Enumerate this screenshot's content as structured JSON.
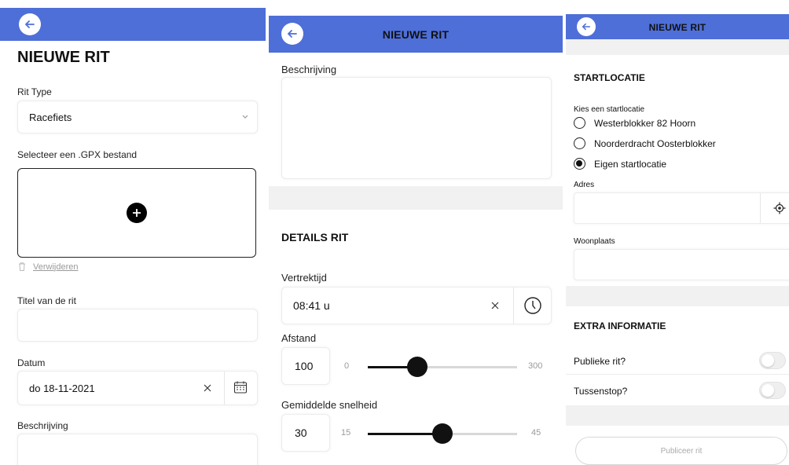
{
  "panel1": {
    "title": "NIEUWE RIT",
    "rit_type_label": "Rit Type",
    "rit_type_value": "Racefiets",
    "gpx_label": "Selecteer een .GPX bestand",
    "remove_label": "Verwijderen",
    "titel_label": "Titel van de rit",
    "titel_value": "",
    "datum_label": "Datum",
    "datum_value": "do 18-11-2021",
    "beschrijving_label": "Beschrijving",
    "icons": [
      "back-arrow-icon",
      "chevron-down-icon",
      "plus-icon",
      "trash-icon",
      "clear-icon",
      "calendar-icon"
    ]
  },
  "panel2": {
    "title": "NIEUWE RIT",
    "beschrijving_label": "Beschrijving",
    "details_heading": "DETAILS RIT",
    "vertrektijd_label": "Vertrektijd",
    "vertrektijd_value": "08:41 u",
    "afstand_label": "Afstand",
    "afstand_value": "100",
    "afstand_min": "0",
    "afstand_max": "300",
    "snelheid_label": "Gemiddelde snelheid",
    "snelheid_value": "30",
    "snelheid_min": "15",
    "snelheid_max": "45",
    "afstand_fraction": 0.333,
    "snelheid_fraction": 0.5,
    "icons": [
      "back-arrow-icon",
      "clear-icon",
      "clock-icon"
    ]
  },
  "panel3": {
    "title": "NIEUWE RIT",
    "startlocatie_heading": "STARTLOCATIE",
    "kies_label": "Kies een startlocatie",
    "options": [
      {
        "label": "Westerblokker 82 Hoorn",
        "selected": false
      },
      {
        "label": "Noorderdracht Oosterblokker",
        "selected": false
      },
      {
        "label": "Eigen startlocatie",
        "selected": true
      }
    ],
    "adres_label": "Adres",
    "adres_value": "",
    "woonplaats_label": "Woonplaats",
    "woonplaats_value": "",
    "extra_heading": "EXTRA INFORMATIE",
    "publieke_label": "Publieke rit?",
    "tussenstop_label": "Tussenstop?",
    "publieke_on": false,
    "tussenstop_on": false,
    "publish_button": "Publiceer rit",
    "icons": [
      "back-arrow-icon",
      "locate-icon"
    ]
  },
  "colors": {
    "header": "#4e6fd8",
    "panel_gray": "#f1f1f1",
    "accent_dark": "#111111"
  }
}
